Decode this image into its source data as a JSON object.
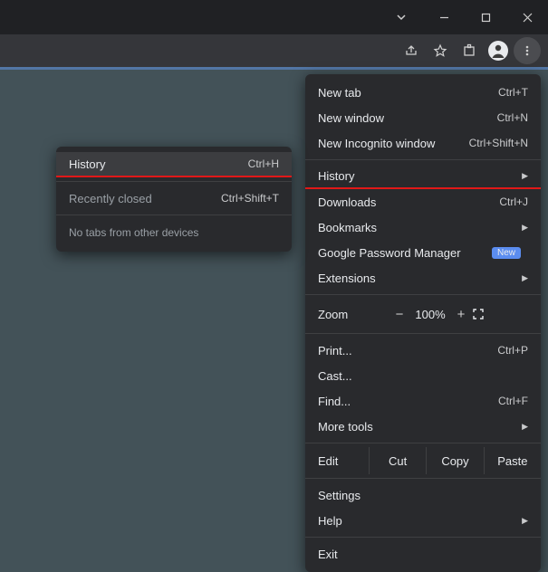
{
  "titlebar": {
    "minimize_tip": "Minimize",
    "maximize_tip": "Maximize",
    "close_tip": "Close"
  },
  "toolbar": {
    "share_tip": "Share",
    "star_tip": "Bookmark",
    "ext_tip": "Extensions",
    "profile_tip": "Profile",
    "menu_tip": "Customize and control"
  },
  "menu": {
    "new_tab": {
      "label": "New tab",
      "shortcut": "Ctrl+T"
    },
    "new_window": {
      "label": "New window",
      "shortcut": "Ctrl+N"
    },
    "new_incognito": {
      "label": "New Incognito window",
      "shortcut": "Ctrl+Shift+N"
    },
    "history": {
      "label": "History"
    },
    "downloads": {
      "label": "Downloads",
      "shortcut": "Ctrl+J"
    },
    "bookmarks": {
      "label": "Bookmarks"
    },
    "pwmgr": {
      "label": "Google Password Manager",
      "badge": "New"
    },
    "extensions": {
      "label": "Extensions"
    },
    "zoom": {
      "label": "Zoom",
      "minus": "−",
      "value": "100%",
      "plus": "+"
    },
    "print": {
      "label": "Print...",
      "shortcut": "Ctrl+P"
    },
    "cast": {
      "label": "Cast..."
    },
    "find": {
      "label": "Find...",
      "shortcut": "Ctrl+F"
    },
    "more_tools": {
      "label": "More tools"
    },
    "edit": {
      "label": "Edit",
      "cut": "Cut",
      "copy": "Copy",
      "paste": "Paste"
    },
    "settings": {
      "label": "Settings"
    },
    "help": {
      "label": "Help"
    },
    "exit": {
      "label": "Exit"
    }
  },
  "submenu": {
    "history": {
      "label": "History",
      "shortcut": "Ctrl+H"
    },
    "recently_closed": {
      "label": "Recently closed",
      "shortcut": "Ctrl+Shift+T"
    },
    "no_tabs": "No tabs from other devices"
  }
}
